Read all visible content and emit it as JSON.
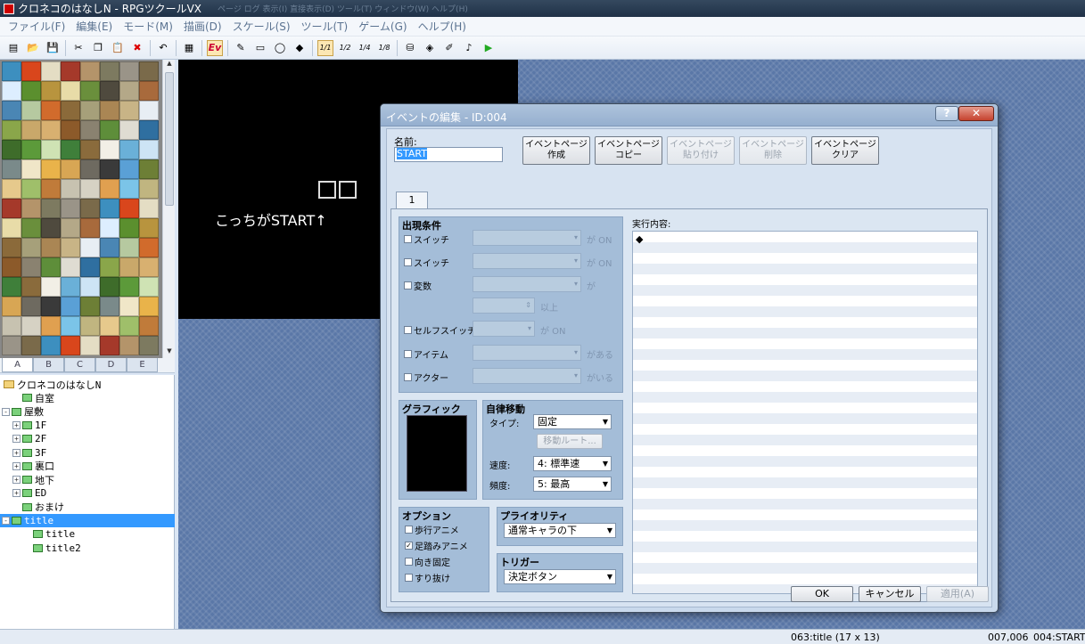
{
  "window": {
    "title": "クロネコのはなしN - RPGツクールVX",
    "ghost_text": [
      "ページ",
      "ログ",
      "表示(I)",
      "直接表示(D)",
      "ツール(T)",
      "ウィンドウ(W)",
      "ヘルプ(H)"
    ]
  },
  "menu": [
    "ファイル(F)",
    "編集(E)",
    "モード(M)",
    "描画(D)",
    "スケール(S)",
    "ツール(T)",
    "ゲーム(G)",
    "ヘルプ(H)"
  ],
  "toolbar": {
    "icons": [
      "new-project-icon",
      "open-project-icon",
      "save-icon",
      "cut-icon",
      "copy-icon",
      "paste-icon",
      "delete-icon",
      "undo-icon",
      "map-layer-icon",
      "event-layer-icon",
      "pencil-icon",
      "rectangle-icon",
      "ellipse-icon",
      "fill-icon",
      "scale-1-1-icon",
      "scale-1-2-icon",
      "scale-1-4-icon",
      "scale-1-8-icon",
      "database-icon",
      "material-icon",
      "script-icon",
      "sound-icon",
      "playtest-icon"
    ],
    "scale_labels": [
      "1/1",
      "1/2",
      "1/4",
      "1/8"
    ],
    "event_label": "Ev"
  },
  "tileset_tabs": [
    "A",
    "B",
    "C",
    "D",
    "E"
  ],
  "map_tree": [
    {
      "label": "クロネコのはなしN",
      "type": "project",
      "indent": 0
    },
    {
      "label": "自室",
      "type": "map",
      "indent": 1
    },
    {
      "label": "屋敷",
      "type": "map",
      "indent": 0,
      "expander": "-"
    },
    {
      "label": "1F",
      "type": "map",
      "indent": 1,
      "expander": "+"
    },
    {
      "label": "2F",
      "type": "map",
      "indent": 1,
      "expander": "+"
    },
    {
      "label": "3F",
      "type": "map",
      "indent": 1,
      "expander": "+"
    },
    {
      "label": "裏口",
      "type": "map",
      "indent": 1,
      "expander": "+"
    },
    {
      "label": "地下",
      "type": "map",
      "indent": 1,
      "expander": "+"
    },
    {
      "label": "ED",
      "type": "map",
      "indent": 1,
      "expander": "+"
    },
    {
      "label": "おまけ",
      "type": "map",
      "indent": 1
    },
    {
      "label": "title",
      "type": "map",
      "indent": 0,
      "expander": "-",
      "selected": true
    },
    {
      "label": "title",
      "type": "map",
      "indent": 2
    },
    {
      "label": "title2",
      "type": "map",
      "indent": 2
    }
  ],
  "map": {
    "text": "こっちがSTART↑"
  },
  "dialog": {
    "title": "イベントの編集 - ID:004",
    "help": "?",
    "close": "✕",
    "name_label": "名前:",
    "name_value": "START",
    "page_buttons": [
      {
        "line1": "イベントページ",
        "line2": "作成",
        "enabled": true
      },
      {
        "line1": "イベントページ",
        "line2": "コピー",
        "enabled": true
      },
      {
        "line1": "イベントページ",
        "line2": "貼り付け",
        "enabled": false
      },
      {
        "line1": "イベントページ",
        "line2": "削除",
        "enabled": false
      },
      {
        "line1": "イベントページ",
        "line2": "クリア",
        "enabled": true
      }
    ],
    "page_tab": "1",
    "conditions": {
      "title": "出現条件",
      "rows": [
        {
          "label": "スイッチ",
          "suffix": "が ON"
        },
        {
          "label": "スイッチ",
          "suffix": "が ON"
        },
        {
          "label": "変数",
          "suffix": "が"
        },
        {
          "label": "",
          "suffix": "以上"
        },
        {
          "label": "セルフスイッチ",
          "suffix": "が ON"
        },
        {
          "label": "アイテム",
          "suffix": "がある"
        },
        {
          "label": "アクター",
          "suffix": "がいる"
        }
      ]
    },
    "graphic": {
      "title": "グラフィック"
    },
    "autonomous": {
      "title": "自律移動",
      "type_label": "タイプ:",
      "type_value": "固定",
      "route_button": "移動ルート...",
      "speed_label": "速度:",
      "speed_value": "4: 標準速",
      "freq_label": "頻度:",
      "freq_value": "5: 最高"
    },
    "options": {
      "title": "オプション",
      "items": [
        {
          "label": "歩行アニメ",
          "checked": false
        },
        {
          "label": "足踏みアニメ",
          "checked": true
        },
        {
          "label": "向き固定",
          "checked": false
        },
        {
          "label": "すり抜け",
          "checked": false
        }
      ]
    },
    "priority": {
      "title": "プライオリティ",
      "value": "通常キャラの下"
    },
    "trigger": {
      "title": "トリガー",
      "value": "決定ボタン"
    },
    "exec": {
      "label": "実行内容:",
      "first": "◆"
    },
    "buttons": {
      "ok": "OK",
      "cancel": "キャンセル",
      "apply": "適用(A)"
    }
  },
  "status": {
    "map": "063:title (17 x 13)",
    "coords": "007,006",
    "event": "004:START"
  }
}
